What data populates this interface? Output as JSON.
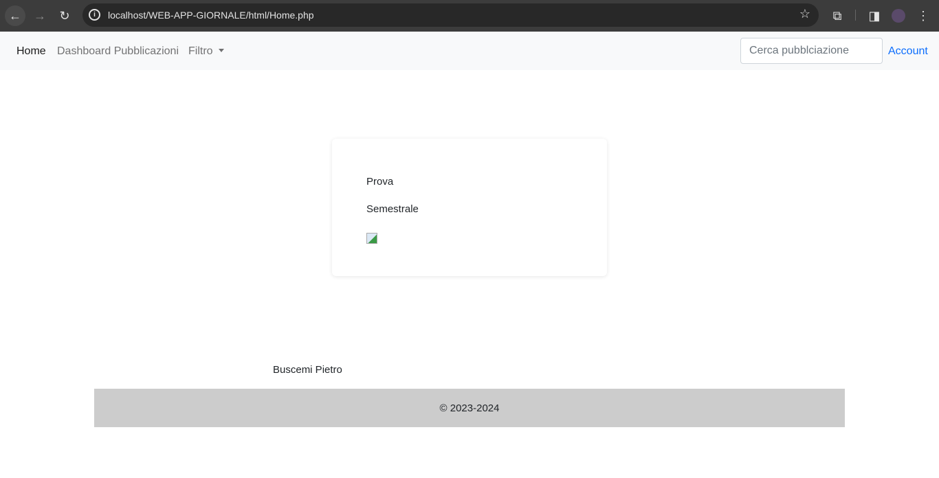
{
  "browser": {
    "url": "localhost/WEB-APP-GIORNALE/html/Home.php"
  },
  "navbar": {
    "home": "Home",
    "dashboard": "Dashboard Pubblicazioni",
    "filter": "Filtro",
    "search_placeholder": "Cerca pubblciazione",
    "account": "Account"
  },
  "card": {
    "title": "Prova",
    "period": "Semestrale"
  },
  "footer": {
    "author": "Buscemi Pietro",
    "copyright": "© 2023-2024"
  },
  "colors": {
    "link": "#0d6efd",
    "footer_bg": "#cccccc"
  }
}
